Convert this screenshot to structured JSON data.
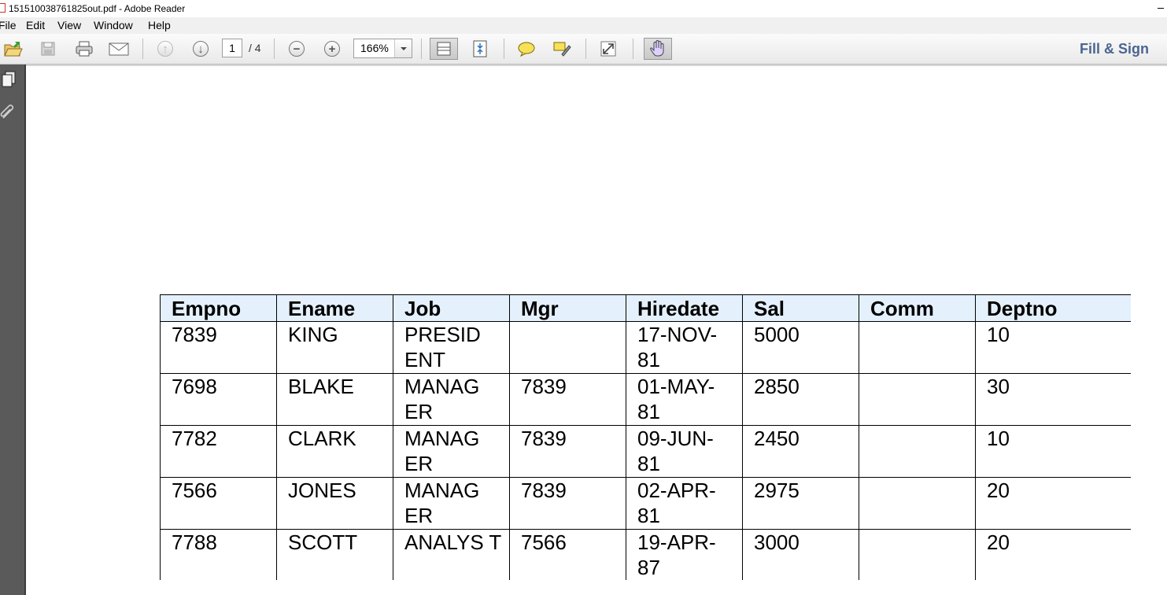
{
  "window": {
    "title": "151510038761825out.pdf - Adobe Reader"
  },
  "menu": [
    "File",
    "Edit",
    "View",
    "Window",
    "Help"
  ],
  "toolbar": {
    "page_current": "1",
    "page_total": "/ 4",
    "zoom": "166%",
    "fill_sign": "Fill & Sign"
  },
  "icons": {
    "open": "open-folder-icon",
    "save": "save-icon",
    "print": "print-icon",
    "email": "email-icon",
    "prev_page": "arrow-up-icon",
    "next_page": "arrow-down-icon",
    "zoom_out": "minus-icon",
    "zoom_in": "plus-icon",
    "scrolling_mode": "page-scroll-icon",
    "fit_page": "fit-page-icon",
    "comment": "sticky-note-icon",
    "highlight": "highlight-pen-icon",
    "full_screen": "expand-icon",
    "hand_tool": "hand-icon"
  },
  "table": {
    "headers": [
      "Empno",
      "Ename",
      "Job",
      "Mgr",
      "Hiredate",
      "Sal",
      "Comm",
      "Deptno"
    ],
    "rows": [
      [
        "7839",
        "KING",
        "PRESID ENT",
        "",
        "17-NOV- 81",
        "5000",
        "",
        "10"
      ],
      [
        "7698",
        "BLAKE",
        "MANAG ER",
        "7839",
        "01-MAY- 81",
        "2850",
        "",
        "30"
      ],
      [
        "7782",
        "CLARK",
        "MANAG ER",
        "7839",
        "09-JUN- 81",
        "2450",
        "",
        "10"
      ],
      [
        "7566",
        "JONES",
        "MANAG ER",
        "7839",
        "02-APR- 81",
        "2975",
        "",
        "20"
      ],
      [
        "7788",
        "SCOTT",
        "ANALYS T",
        "7566",
        "19-APR- 87",
        "3000",
        "",
        "20"
      ]
    ]
  }
}
